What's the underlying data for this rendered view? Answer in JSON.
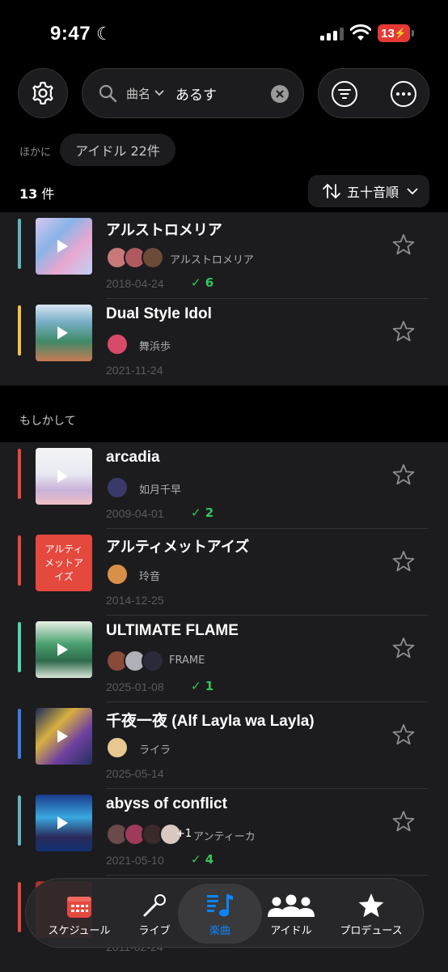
{
  "status": {
    "time": "9:47",
    "battery": "13"
  },
  "search": {
    "field": "曲名",
    "query": "あるす"
  },
  "other": {
    "label": "ほかに",
    "chip": "アイドル 22件"
  },
  "results": {
    "count": "13",
    "unit": "件"
  },
  "sort": {
    "label": "五十音順"
  },
  "section": {
    "maybe": "もしかして"
  },
  "songs": [
    {
      "title": "アルストロメリア",
      "artist": "アルストロメリア",
      "date": "2018-04-24",
      "checks": "6",
      "bar_color": "#5fb5c0"
    },
    {
      "title": "Dual Style Idol",
      "artist": "舞浜歩",
      "date": "2021-11-24",
      "checks": "",
      "bar_color": "#f2c343"
    }
  ],
  "suggestions": [
    {
      "title": "arcadia",
      "artist": "如月千早",
      "date": "2009-04-01",
      "checks": "2",
      "bar_color": "#e5483d"
    },
    {
      "title": "アルティメットアイズ",
      "artist": "玲音",
      "date": "2014-12-25",
      "checks": "",
      "bar_color": "#e5483d",
      "jacket_text": "アルティメットアイズ"
    },
    {
      "title": "ULTIMATE FLAME",
      "artist": "FRAME",
      "date": "2025-01-08",
      "checks": "1",
      "bar_color": "#4fd5b5"
    },
    {
      "title": "千夜一夜 (Alf Layla wa Layla)",
      "artist": "ライラ",
      "date": "2025-05-14",
      "checks": "",
      "bar_color": "#3b7de0"
    },
    {
      "title": "abyss of conflict",
      "artist": "アンティーカ",
      "extra": "+1",
      "date": "2021-05-10",
      "checks": "4",
      "bar_color": "#5fb5c0"
    }
  ],
  "partial_row": {
    "date": "2011-02-24"
  },
  "tabs": [
    {
      "label": "スケジュール",
      "icon": "calendar-icon"
    },
    {
      "label": "ライブ",
      "icon": "microphone-icon"
    },
    {
      "label": "楽曲",
      "icon": "music-note-icon"
    },
    {
      "label": "アイドル",
      "icon": "people-icon"
    },
    {
      "label": "プロデュース",
      "icon": "star-icon"
    }
  ],
  "colors": {
    "accent": "#0a84ff",
    "check": "#34c759",
    "background": "#000000",
    "card": "#1c1c1e"
  }
}
